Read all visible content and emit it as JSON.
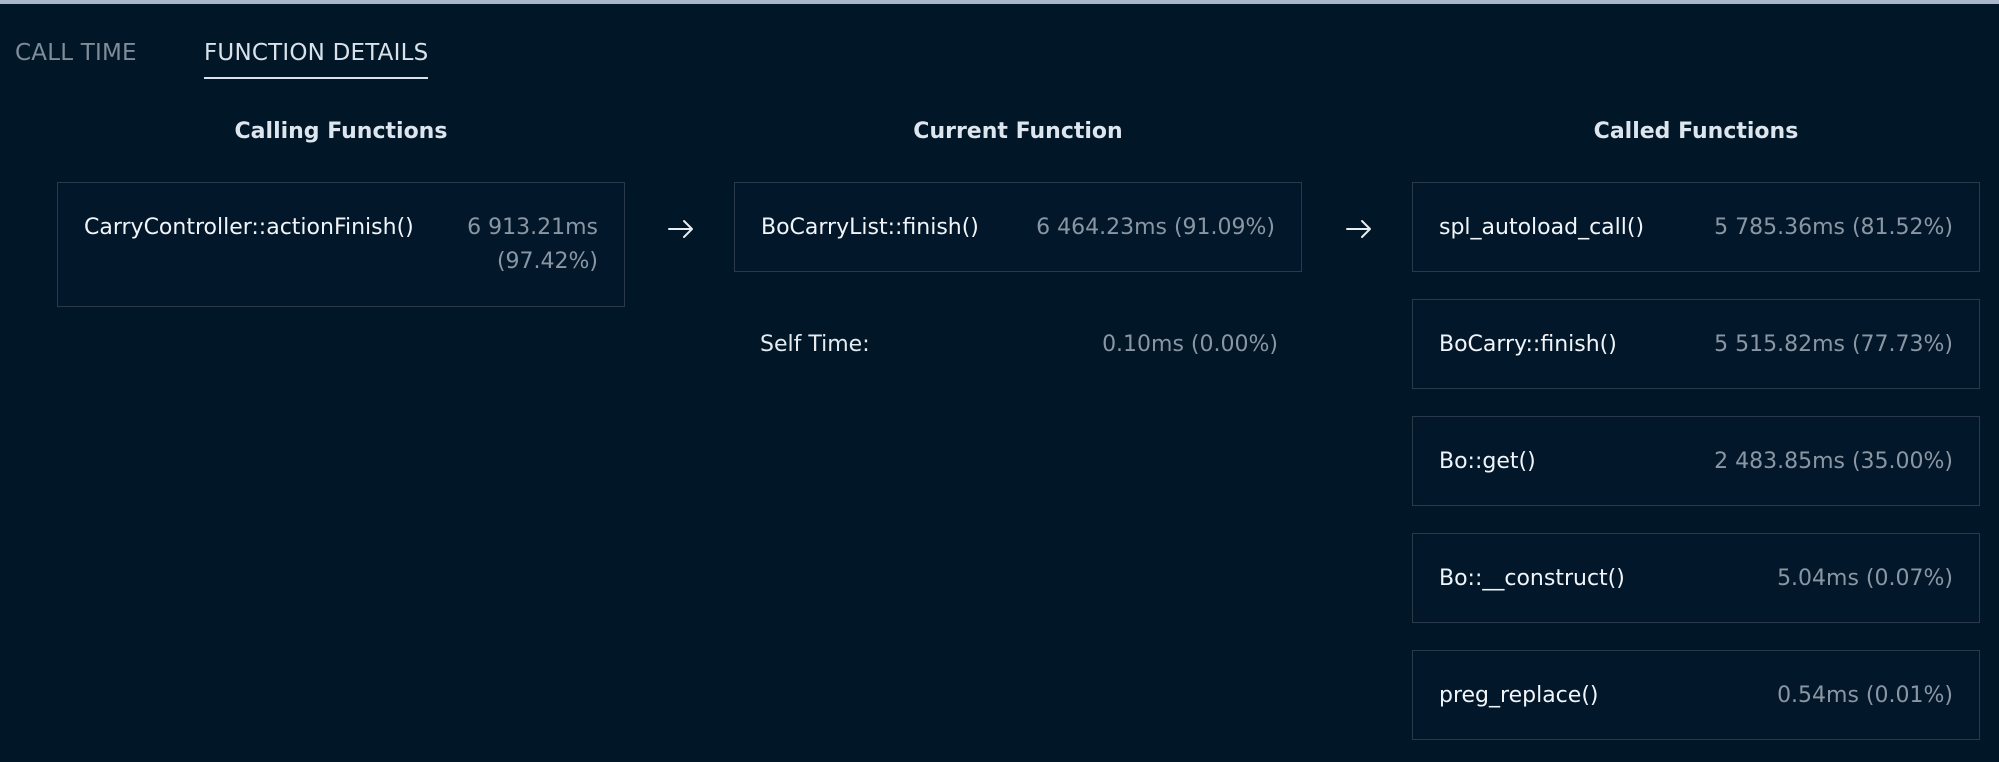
{
  "tabs": [
    {
      "label": "CALL TIME",
      "active": false
    },
    {
      "label": "FUNCTION DETAILS",
      "active": true
    }
  ],
  "columns": {
    "calling_heading": "Calling Functions",
    "current_heading": "Current Function",
    "called_heading": "Called Functions"
  },
  "calling": [
    {
      "name": "CarryController::actionFinish()",
      "time": "6 913.21ms",
      "pct": "(97.42%)"
    }
  ],
  "current": {
    "name": "BoCarryList::finish()",
    "time": "6 464.23ms (91.09%)",
    "self_label": "Self Time:",
    "self_value": "0.10ms (0.00%)"
  },
  "called": [
    {
      "name": "spl_autoload_call()",
      "time": "5 785.36ms (81.52%)"
    },
    {
      "name": "BoCarry::finish()",
      "time": "5 515.82ms (77.73%)"
    },
    {
      "name": "Bo::get()",
      "time": "2 483.85ms (35.00%)"
    },
    {
      "name": "Bo::__construct()",
      "time": "5.04ms (0.07%)"
    },
    {
      "name": "preg_replace()",
      "time": "0.54ms (0.01%)"
    }
  ],
  "icons": {
    "arrow": "arrow-right-icon"
  },
  "colors": {
    "background": "#011627",
    "border": "#2b3a4a",
    "muted_text": "#8a96a3",
    "text": "#f1f4f8"
  }
}
